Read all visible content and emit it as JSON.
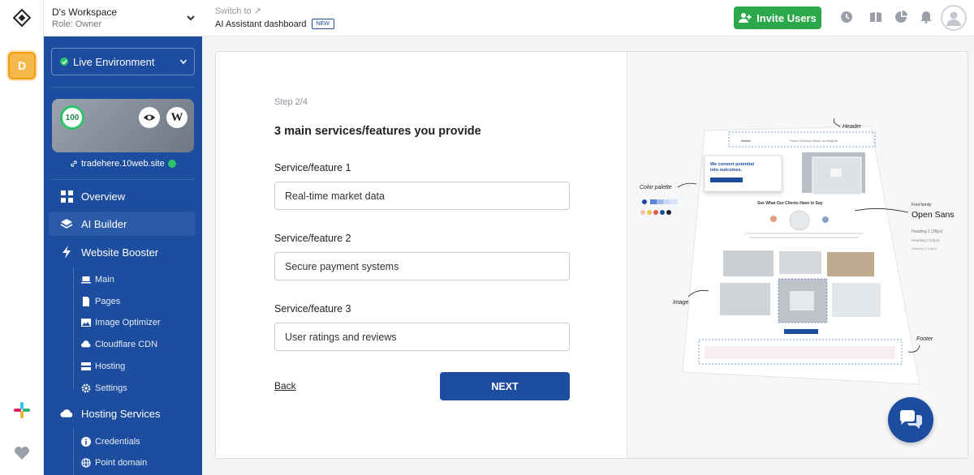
{
  "workspace": {
    "name": "D's Workspace",
    "role": "Role: Owner",
    "avatar_letter": "D"
  },
  "environment": {
    "label": "Live Environment"
  },
  "site": {
    "score": "100",
    "url": "tradehere.10web.site",
    "wp_label": "W"
  },
  "nav": {
    "overview": "Overview",
    "ai_builder": "AI Builder",
    "website_booster": "Website Booster",
    "booster_items": [
      "Main",
      "Pages",
      "Image Optimizer",
      "Cloudflare CDN",
      "Hosting",
      "Settings"
    ],
    "hosting_services": "Hosting Services",
    "hosting_items": [
      "Credentials",
      "Point domain"
    ]
  },
  "topbar": {
    "switch_to": "Switch to ↗",
    "assistant_label": "AI Assistant dashboard",
    "new_badge": "NEW",
    "invite_label": "Invite Users"
  },
  "form": {
    "step": "Step 2/4",
    "title": "3 main services/features you provide",
    "fields": [
      {
        "label": "Service/feature 1",
        "value": "Real-time market data"
      },
      {
        "label": "Service/feature 2",
        "value": "Secure payment systems"
      },
      {
        "label": "Service/feature 3",
        "value": "User ratings and reviews"
      }
    ],
    "back_label": "Back",
    "next_label": "NEXT"
  },
  "preview": {
    "header_label": "Header",
    "color_palette_label": "Color palette",
    "font_family_label": "Font family",
    "font_name": "Open Sans",
    "heading_1": "Heading 1 (28px)",
    "heading_2": "Heading 2 (22px)",
    "heading_3": "Heading 3 (18px)",
    "image_label": "Image",
    "footer_label": "Footer",
    "hero_text": "We convert potential into outcomes.",
    "clients_text": "See What Our Clients Have to Say",
    "palette_colors": [
      "#1c4d9e",
      "#5b86d6",
      "#9db8ea",
      "#c7d6f4",
      "#f4a08a",
      "#f2c14e",
      "#e2574c",
      "#1c4d9e",
      "#223"
    ]
  },
  "colors": {
    "accent": "#1c4d9e",
    "success": "#2ba84a",
    "warning": "#f7b84b"
  }
}
